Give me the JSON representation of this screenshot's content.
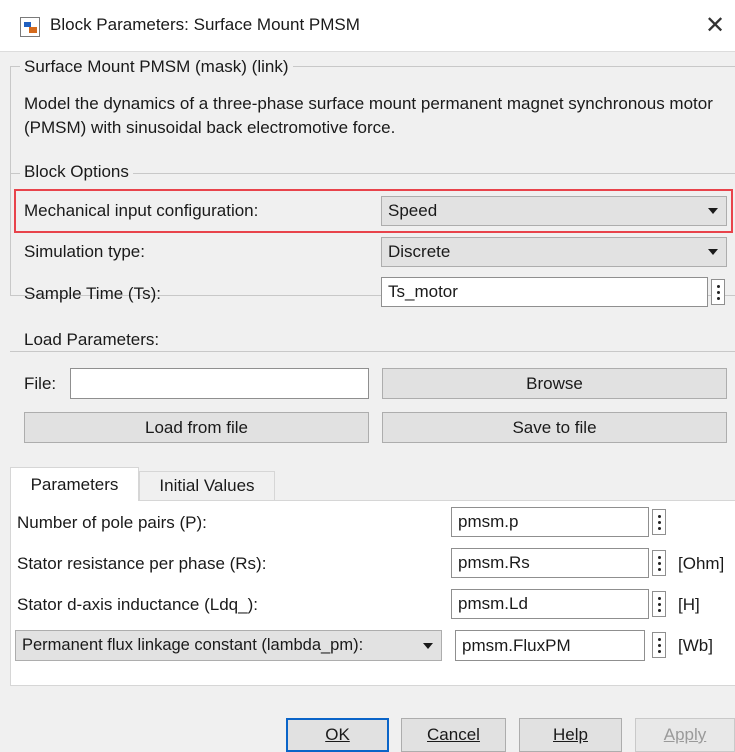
{
  "window": {
    "title": "Block Parameters: Surface Mount PMSM",
    "close_glyph": "✕"
  },
  "mask": {
    "legend": "Surface Mount PMSM (mask) (link)",
    "description": "Model the dynamics of a three-phase surface mount permanent magnet synchronous motor (PMSM) with sinusoidal back electromotive force."
  },
  "block_options": {
    "legend": "Block Options",
    "mechanical_input": {
      "label": "Mechanical input configuration:",
      "value": "Speed"
    },
    "simulation_type": {
      "label": "Simulation type:",
      "value": "Discrete"
    },
    "sample_time": {
      "label": "Sample Time (Ts):",
      "value": "Ts_motor"
    }
  },
  "load_parameters": {
    "legend": "Load Parameters:",
    "file_label": "File:",
    "file_value": "",
    "browse_label": "Browse",
    "load_label": "Load from file",
    "save_label": "Save to file"
  },
  "tabs": [
    {
      "label": "Parameters",
      "selected": true
    },
    {
      "label": "Initial Values",
      "selected": false
    }
  ],
  "parameters": [
    {
      "label": "Number of pole pairs (P):",
      "value": "pmsm.p",
      "unit": ""
    },
    {
      "label": "Stator resistance per phase (Rs):",
      "value": "pmsm.Rs",
      "unit": "[Ohm]"
    },
    {
      "label": "Stator d-axis inductance (Ldq_):",
      "value": "pmsm.Ld",
      "unit": "[H]"
    },
    {
      "label": "Permanent flux linkage constant (lambda_pm):",
      "value": "pmsm.FluxPM",
      "unit": "[Wb]"
    }
  ],
  "buttons": {
    "ok": "OK",
    "cancel": "Cancel",
    "help": "Help",
    "apply": "Apply"
  }
}
